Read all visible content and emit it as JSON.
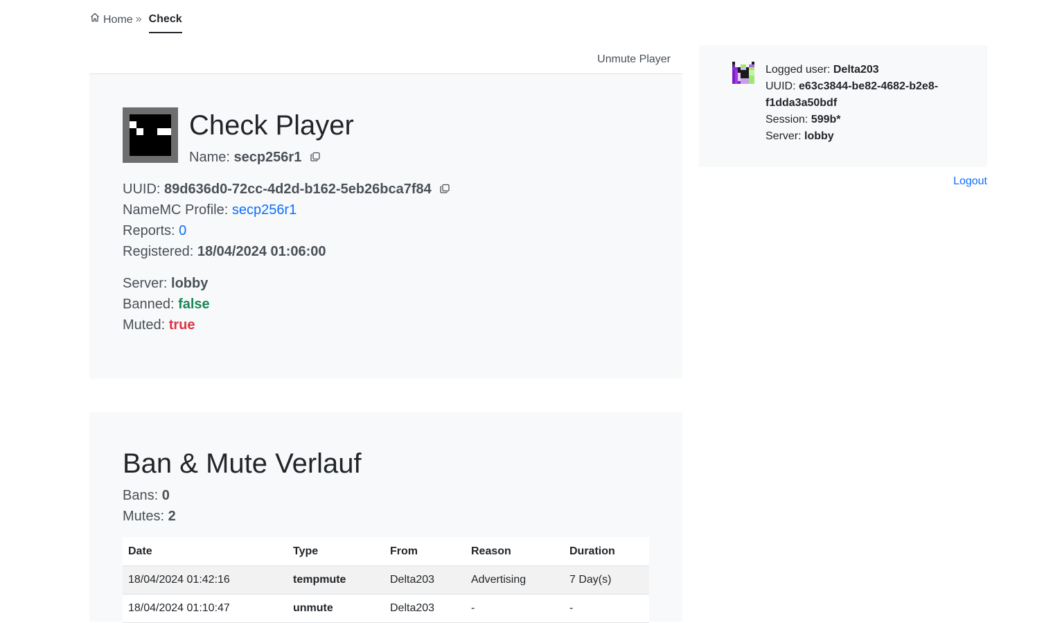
{
  "breadcrumb": {
    "home": "Home",
    "separator": "»",
    "current": "Check"
  },
  "tabs": {
    "unmute": "Unmute Player"
  },
  "player": {
    "title": "Check Player",
    "name_label": "Name:",
    "name": "secp256r1",
    "uuid_label": "UUID:",
    "uuid": "89d636d0-72cc-4d2d-b162-5eb26bca7f84",
    "namemc_label": "NameMC Profile:",
    "namemc": "secp256r1",
    "reports_label": "Reports:",
    "reports": "0",
    "registered_label": "Registered:",
    "registered": "18/04/2024 01:06:00",
    "server_label": "Server:",
    "server": "lobby",
    "banned_label": "Banned:",
    "banned": "false",
    "muted_label": "Muted:",
    "muted": "true"
  },
  "user": {
    "logged_label": "Logged user:",
    "logged": "Delta203",
    "uuid_label": "UUID:",
    "uuid": "e63c3844-be82-4682-b2e8-f1dda3a50bdf",
    "session_label": "Session:",
    "session": "599b*",
    "server_label": "Server:",
    "server": "lobby",
    "logout": "Logout"
  },
  "history": {
    "title": "Ban & Mute Verlauf",
    "bans_label": "Bans:",
    "bans": "0",
    "mutes_label": "Mutes:",
    "mutes": "2",
    "columns": [
      "Date",
      "Type",
      "From",
      "Reason",
      "Duration"
    ],
    "rows": [
      [
        "18/04/2024 01:42:16",
        "tempmute",
        "Delta203",
        "Advertising",
        "7 Day(s)"
      ],
      [
        "18/04/2024 01:10:47",
        "unmute",
        "Delta203",
        "-",
        "-"
      ]
    ]
  },
  "colors": {
    "link": "#0d6efd",
    "true": "#dc3545",
    "false": "#198754",
    "card": "#f8f9fa"
  },
  "icons": {
    "home": "house-icon",
    "copy": "copy-icon"
  }
}
